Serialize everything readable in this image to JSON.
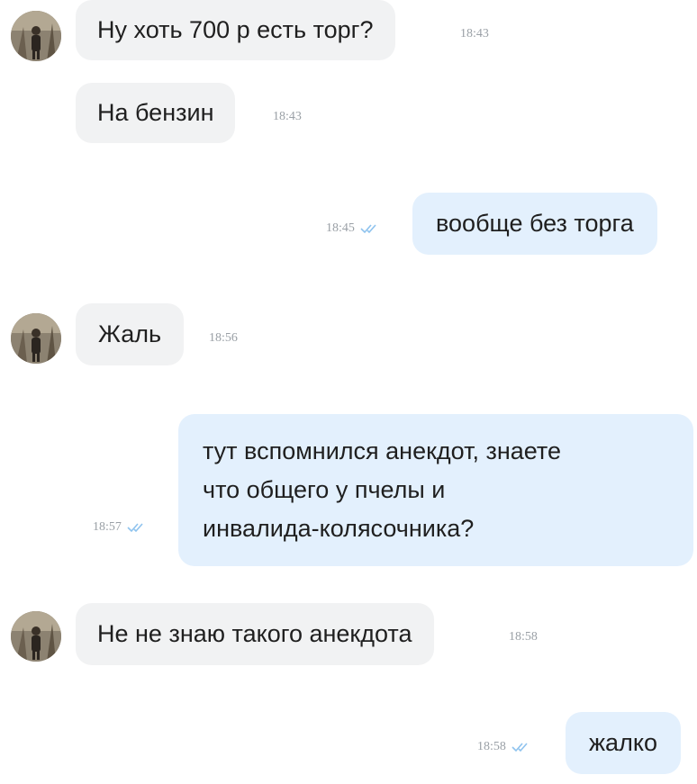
{
  "messages": [
    {
      "id": "m1",
      "direction": "incoming",
      "text": "Ну хоть 700 р есть торг?",
      "time": "18:43"
    },
    {
      "id": "m2",
      "direction": "incoming",
      "text": "На бензин",
      "time": "18:43"
    },
    {
      "id": "m3",
      "direction": "outgoing",
      "text": "вообще без торга",
      "time": "18:45",
      "read": true
    },
    {
      "id": "m4",
      "direction": "incoming",
      "text": "Жаль",
      "time": "18:56"
    },
    {
      "id": "m5",
      "direction": "outgoing",
      "lines": [
        "тут вспомнился анекдот, знаете",
        "что общего у пчелы и",
        "инвалида-колясочника?"
      ],
      "time": "18:57",
      "read": true
    },
    {
      "id": "m6",
      "direction": "incoming",
      "text": "Не не знаю такого анекдота",
      "time": "18:58"
    },
    {
      "id": "m7",
      "direction": "outgoing",
      "text": "жалко",
      "time": "18:58",
      "read": true
    }
  ],
  "colors": {
    "incoming_bubble": "#f1f2f3",
    "outgoing_bubble": "#e3f0fd",
    "timestamp": "#9aa0a6",
    "read_check": "#8fc3ee"
  },
  "icons": {
    "avatar": "user-avatar-photo",
    "read": "double-check-icon"
  }
}
